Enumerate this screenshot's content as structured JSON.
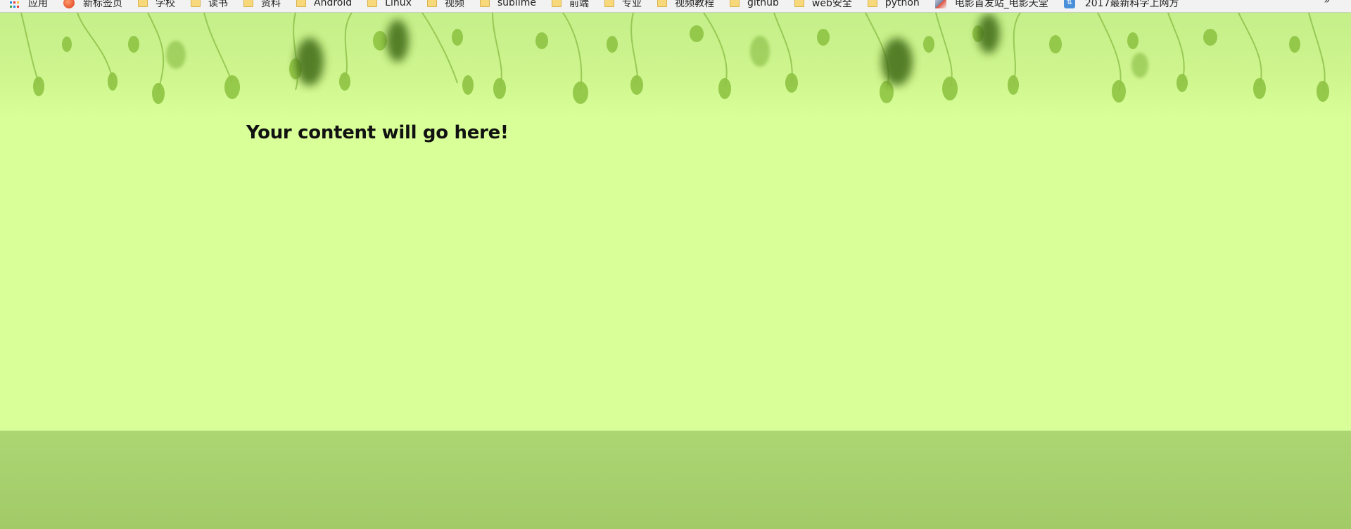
{
  "bookmarks": {
    "items": [
      {
        "label": "应用",
        "icon": "apps-icon"
      },
      {
        "label": "新标签页",
        "icon": "new-tab-icon"
      },
      {
        "label": "学校",
        "icon": "folder-icon"
      },
      {
        "label": "读书",
        "icon": "folder-icon"
      },
      {
        "label": "资料",
        "icon": "folder-icon"
      },
      {
        "label": "Android",
        "icon": "folder-icon"
      },
      {
        "label": "Linux",
        "icon": "folder-icon"
      },
      {
        "label": "视频",
        "icon": "folder-icon"
      },
      {
        "label": "sublime",
        "icon": "folder-icon"
      },
      {
        "label": "前端",
        "icon": "folder-icon"
      },
      {
        "label": "专业",
        "icon": "folder-icon"
      },
      {
        "label": "视频教程",
        "icon": "folder-icon"
      },
      {
        "label": "github",
        "icon": "folder-icon"
      },
      {
        "label": "web安全",
        "icon": "folder-icon"
      },
      {
        "label": "python",
        "icon": "folder-icon"
      },
      {
        "label": "电影首发站_电影天堂",
        "icon": "page-icon"
      },
      {
        "label": "2017最新科学上网方",
        "icon": "page-icon"
      }
    ],
    "overflow": "»"
  },
  "main": {
    "heading": "Your content will go here!"
  },
  "colors": {
    "background": "#d8ff98",
    "footer": "#a6cf6c",
    "leaf": "#8cc63f",
    "leaf_dark": "#3f6b12"
  }
}
